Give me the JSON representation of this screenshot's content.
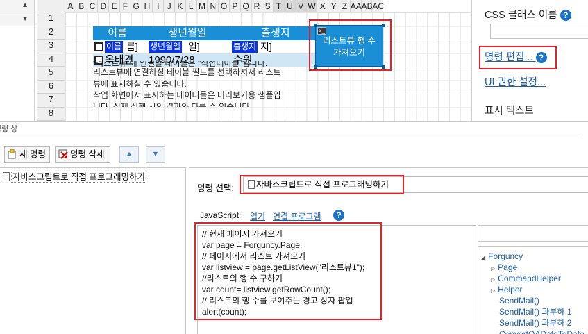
{
  "sheet": {
    "columns": [
      "A",
      "B",
      "C",
      "D",
      "E",
      "F",
      "G",
      "H",
      "I",
      "J",
      "K",
      "L",
      "M",
      "N",
      "O",
      "P",
      "Q",
      "R",
      "S",
      "T",
      "U",
      "V",
      "W",
      "X",
      "Y",
      "Z",
      "AA",
      "AB",
      "AC"
    ],
    "selected_columns": [
      "T",
      "U",
      "V",
      "W"
    ],
    "rows": [
      "1",
      "2",
      "3",
      "4",
      "5",
      "6",
      "7",
      "8"
    ],
    "listview": {
      "headers": [
        "이름",
        "생년월일",
        "출생지"
      ],
      "row1": {
        "name_tag": "이름",
        "name_suffix": "름]",
        "birth_tag": "생년월일",
        "birth_suffix": "일]",
        "place_tag": "출생지",
        "place_suffix": "지]"
      },
      "row2": {
        "name": "옥태견",
        "birth": "1990/7/28",
        "place": "수원"
      }
    },
    "background_text": [
      "\"리스트뷰\"에 연결할 테이블은 \"직접테이블\"입니다.",
      "리스트뷰에 연결하실 테이블 필드를 선택하셔서 리스트",
      "뷰에 표시하실 수 있습니다.",
      "작업 화면에서 표시하는 데이터들은 미리보기용 샘플입",
      "니다. 실제 실행 시의 결과와 다를 수 있습니다."
    ],
    "button_label_line1": "리스트뷰 행 수",
    "button_label_line2": "가져오기",
    "button_terminal_glyph": ">_"
  },
  "right_panel": {
    "css_class_label": "CSS 클래스 이름",
    "command_edit_link": "명령 편집...",
    "ui_permission_link": "UI 권한 설정...",
    "display_text_label": "표시 텍스트"
  },
  "command_window": {
    "title": "명령 창",
    "new_command": "새 명령",
    "delete_command": "명령 삭제",
    "commands": [
      "자바스크립트로 직접 프로그래밍하기"
    ],
    "selection_label": "명령 선택:",
    "selected_command": "자바스크립트로 직접 프로그래밍하기",
    "javascript_label": "JavaScript:",
    "open_link": "열기",
    "associated_program_link": "연결 프로그램",
    "code_lines": [
      "// 현재 페이지 가져오기",
      "var page = Forguncy.Page;",
      "// 페이지에서 리스트 가져오기",
      "var listview = page.getListView(\"리스트뷰1\");",
      "//리스트의 행 수 구하기",
      "var count= listview.getRowCount();",
      "// 리스트의 행 수를 보여주는 경고 상자 팝업",
      "alert(count);"
    ],
    "tree": {
      "root": "Forguncy",
      "children": [
        "Page",
        "CommandHelper",
        "Helper"
      ],
      "methods": [
        "SendMail()",
        "SendMail() 과부하 1",
        "SendMail() 과부하 2",
        "ConvertOADateToDate"
      ]
    }
  },
  "colors": {
    "accent_blue": "#1a8fd5",
    "tag_blue": "#0a35e6",
    "highlight_red": "#e0242c",
    "link_blue": "#1a5fb4"
  }
}
